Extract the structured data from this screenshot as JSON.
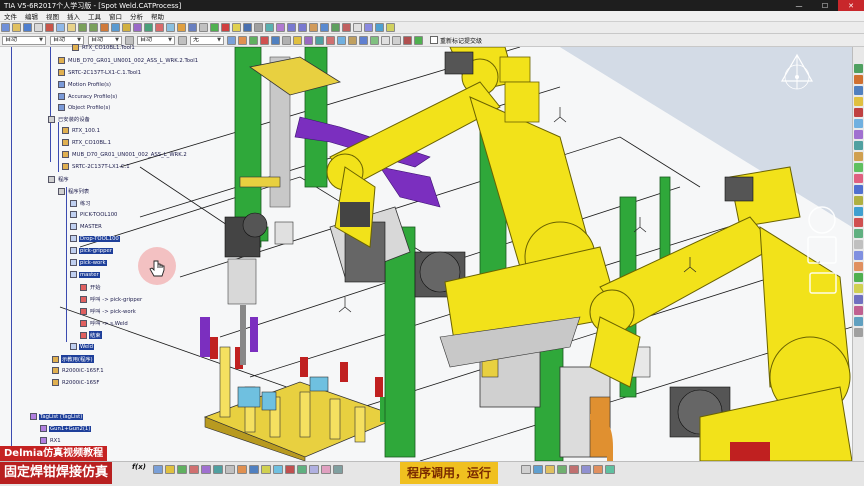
{
  "window": {
    "title": "TIA V5-6R2017个人学习版 - [Spot Weld.CATProcess]"
  },
  "menu": [
    "文件",
    "编辑",
    "视图",
    "插入",
    "工具",
    "窗口",
    "分析",
    "帮助"
  ],
  "toolbar": {
    "select_1": "自动",
    "select_2": "自动",
    "select_3": "自动",
    "select_4": "自动",
    "select_5": "无",
    "checkbox_label": "重新标记提交级"
  },
  "tree": {
    "nodes": [
      {
        "label": "RTX_CO10BL1.Tool1",
        "selected": false
      },
      {
        "label": "MUB_D70_GR01_UN001_002_ASS_L_WRK.2.Tool1",
        "selected": false
      },
      {
        "label": "SRTC-2C137T-LX1-C.1.Tool1",
        "selected": false
      },
      {
        "label": "Motion Profile(s)",
        "selected": false
      },
      {
        "label": "Accuracy Profile(s)",
        "selected": false
      },
      {
        "label": "Object Profile(s)",
        "selected": false
      },
      {
        "label": "已安装的设备",
        "selected": false
      },
      {
        "label": "RTX_100.1",
        "selected": false
      },
      {
        "label": "RTX_CO10BL.1",
        "selected": false
      },
      {
        "label": "MUB_D70_GR01_UN001_002_ASS_L_WRK.2",
        "selected": false
      },
      {
        "label": "SRTC-2C137T-LX1-C.1",
        "selected": false
      },
      {
        "label": "程序",
        "selected": false
      },
      {
        "label": "程序列表",
        "selected": false
      },
      {
        "label": "练习",
        "selected": false
      },
      {
        "label": "PICK-TOOL100",
        "selected": false
      },
      {
        "label": "MASTER",
        "selected": false
      },
      {
        "label": "Drop-TOOL100",
        "selected": true
      },
      {
        "label": "pick-gripper",
        "selected": true
      },
      {
        "label": "pick-work",
        "selected": true
      },
      {
        "label": "master",
        "selected": true
      },
      {
        "label": "开始",
        "selected": false
      },
      {
        "label": "呼叫 -> pick-gripper",
        "selected": false
      },
      {
        "label": "呼叫 -> pick-work",
        "selected": false
      },
      {
        "label": "呼叫 -> s.Weld",
        "selected": false
      },
      {
        "label": "结束",
        "selected": false
      },
      {
        "label": "Weld",
        "selected": false
      },
      {
        "label": "示教用(程序)",
        "selected": false
      },
      {
        "label": "R2000iC-165F.1",
        "selected": false
      },
      {
        "label": "R2000iC-165F",
        "selected": false
      },
      {
        "label": "TagList (TagList)",
        "selected": false
      },
      {
        "label": "Gun1+Gun2(1)",
        "selected": false
      },
      {
        "label": "RX1",
        "selected": false
      }
    ]
  },
  "overlays": {
    "brand": "Delmia仿真视频教程",
    "course_title": "固定焊钳焊接仿真",
    "caption": "程序调用，运行"
  },
  "status": {
    "formula_label": "f(x)"
  },
  "colors": {
    "robot_yellow": "#f2e21a",
    "fixture_green": "#2fa83a",
    "gripper_purple": "#7b2fbf",
    "overlay_red": "#c52222",
    "caption_gold": "#f0c020",
    "tree_selection": "#1e3f9a"
  }
}
